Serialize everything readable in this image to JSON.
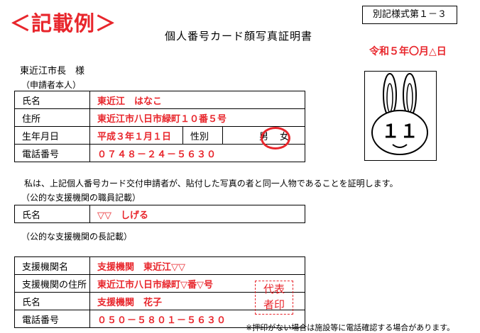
{
  "header": {
    "sample_label": "＜記載例＞",
    "form_number": "別記様式第１－３",
    "title": "個人番号カード顔写真証明書",
    "date": "令和５年〇月△日",
    "addressee": "東近江市長　様"
  },
  "applicant": {
    "section_label": "（申請者本人）",
    "name_label": "氏名",
    "name_value": "東近江　はなこ",
    "address_label": "住所",
    "address_value": "東近江市八日市緑町１０番５号",
    "birth_label": "生年月日",
    "birth_value": "平成３年１月１日",
    "sex_label": "性別",
    "male": "男",
    "female": "女",
    "phone_label": "電話番号",
    "phone_value": "０７４８－２４－５６３０"
  },
  "statement": "私は、上記個人番号カード交付申請者が、貼付した写真の者と同一人物であることを証明します。",
  "staff": {
    "section_label": "（公的な支援機関の職員記載）",
    "name_label": "氏名",
    "name_value": "▽▽　しげる"
  },
  "institution": {
    "section_label": "（公的な支援機関の長記載）",
    "org_label": "支援機関名",
    "org_value": "支援機関　東近江▽▽",
    "address_label": "支援機関の住所",
    "address_value": "東近江市八日市緑町▽番▽号",
    "name_label": "氏名",
    "name_value": "支援機関　花子",
    "phone_label": "電話番号",
    "phone_value": "０５０－５８０１－５６３０",
    "seal_line1": "代表",
    "seal_line2": "者印"
  },
  "footnote": "※押印がない場合は施設等に電話確認する場合があります。",
  "photo": {
    "mascot_digits": "１１"
  },
  "colors": {
    "accent": "#e8262c"
  }
}
